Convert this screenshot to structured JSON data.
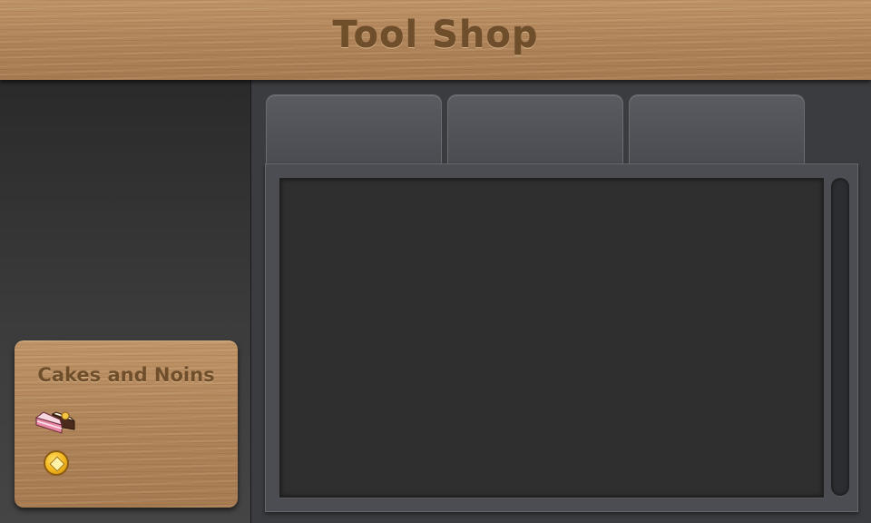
{
  "header": {
    "title": "Tool Shop"
  },
  "tabs": [
    {
      "label": ""
    },
    {
      "label": ""
    },
    {
      "label": ""
    }
  ],
  "currency_card": {
    "title": "Cakes and Noins",
    "cakes": {
      "icon": "cake-icon",
      "value": ""
    },
    "noins": {
      "icon": "coin-icon",
      "value": ""
    }
  },
  "colors": {
    "wood": "#b58a5c",
    "wood_text": "#6f4e2c",
    "panel": "#4c4d53",
    "list_bg": "#2f2f2f"
  }
}
